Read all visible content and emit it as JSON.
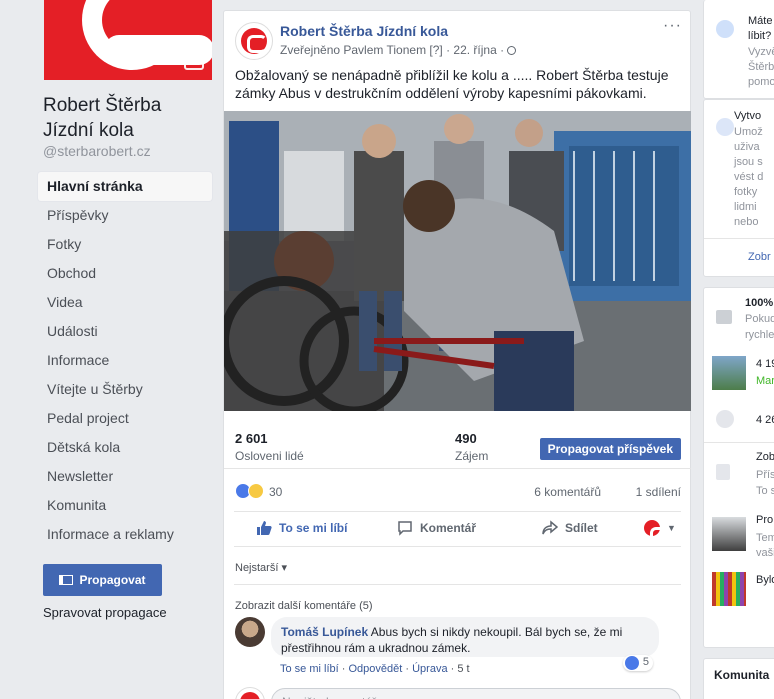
{
  "page": {
    "name": "Robert Štěrba Jízdní kola",
    "handle": "@sterbarobert.cz"
  },
  "nav": {
    "items": [
      {
        "label": "Hlavní stránka",
        "active": true
      },
      {
        "label": "Příspěvky"
      },
      {
        "label": "Fotky"
      },
      {
        "label": "Obchod"
      },
      {
        "label": "Videa"
      },
      {
        "label": "Události"
      },
      {
        "label": "Informace"
      },
      {
        "label": "Vítejte u Štěrby"
      },
      {
        "label": "Pedal project"
      },
      {
        "label": "Dětská kola"
      },
      {
        "label": "Newsletter"
      },
      {
        "label": "Komunita"
      },
      {
        "label": "Informace a reklamy"
      }
    ],
    "promote_label": "Propagovat",
    "manage_label": "Spravovat propagace"
  },
  "post": {
    "author": "Robert Štěrba Jízdní kola",
    "meta": "Zveřejněno Pavlem Tionem [?] · 22. října · ",
    "text": "Obžalovaný se nenápadně přiblížil ke kolu a ..... Robert Štěrba testuje zámky Abus v destrukčním oddělení výroby kapesními pákovkami.",
    "more": "···",
    "stats": {
      "reach_value": "2 601",
      "reach_label": "Osloveni lidé",
      "engagement_value": "490",
      "engagement_label": "Zájem",
      "boost_label": "Propagovat příspěvek"
    },
    "reactions": {
      "count": "30",
      "comments": "6 komentářů",
      "shares": "1 sdílení"
    },
    "actions": {
      "like": "To se mi líbí",
      "comment": "Komentář",
      "share": "Sdílet"
    },
    "sort_label": "Nejstarší ▾",
    "more_comments": "Zobrazit další komentáře (5)",
    "comment": {
      "author": "Tomáš Lupínek",
      "text": " Abus bych si nikdy nekoupil. Bál bych se, že mi přestřihnou rám a ukradnou zámek.",
      "like": "To se mi líbí",
      "reply": "Odpovědět",
      "edit": "Úprava",
      "age": "5 t",
      "likes": "5"
    },
    "compose_placeholder": "Napište komentář..."
  },
  "right": {
    "card1": {
      "title": "Máte",
      "title2": "líbit?",
      "line1": "Vyzvě",
      "line2": "Štěrb",
      "line3": "pomo"
    },
    "card2": {
      "title": "Vytvo",
      "line1": "Umož",
      "line2": "uživa",
      "line3": "jsou s",
      "line4": "vést d",
      "line5": "fotky",
      "line6": "lidmi",
      "line7": "nebo",
      "link": "Zobr"
    },
    "card3": {
      "pct": "100%",
      "line1": "Pokud",
      "line2": "rychle",
      "stat1": "4 19",
      "stat1b": "Mar",
      "stat2": "4 26",
      "line3": "Zob",
      "line4": "Přís",
      "line5": "To s",
      "line6": "Pro",
      "line7": "Tem",
      "line8": "vaši",
      "line9": "Bylo"
    },
    "card4": {
      "title": "Komunita"
    }
  },
  "colors": {
    "brand": "#e41f26",
    "link": "#385898",
    "button": "#4267b2",
    "background": "#e9ebee"
  }
}
